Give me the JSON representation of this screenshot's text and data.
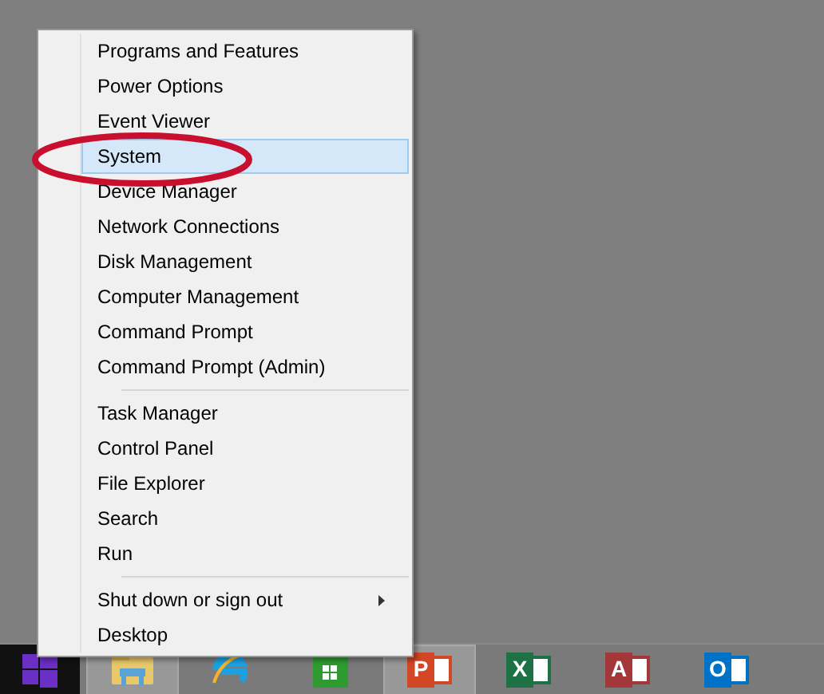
{
  "menu": {
    "groups": [
      {
        "items": [
          {
            "label": "Programs and Features",
            "selected": false,
            "has_submenu": false
          },
          {
            "label": "Power Options",
            "selected": false,
            "has_submenu": false
          },
          {
            "label": "Event Viewer",
            "selected": false,
            "has_submenu": false
          },
          {
            "label": "System",
            "selected": true,
            "has_submenu": false,
            "circled": true
          },
          {
            "label": "Device Manager",
            "selected": false,
            "has_submenu": false
          },
          {
            "label": "Network Connections",
            "selected": false,
            "has_submenu": false
          },
          {
            "label": "Disk Management",
            "selected": false,
            "has_submenu": false
          },
          {
            "label": "Computer Management",
            "selected": false,
            "has_submenu": false
          },
          {
            "label": "Command Prompt",
            "selected": false,
            "has_submenu": false
          },
          {
            "label": "Command Prompt (Admin)",
            "selected": false,
            "has_submenu": false
          }
        ]
      },
      {
        "items": [
          {
            "label": "Task Manager",
            "selected": false,
            "has_submenu": false
          },
          {
            "label": "Control Panel",
            "selected": false,
            "has_submenu": false
          },
          {
            "label": "File Explorer",
            "selected": false,
            "has_submenu": false
          },
          {
            "label": "Search",
            "selected": false,
            "has_submenu": false
          },
          {
            "label": "Run",
            "selected": false,
            "has_submenu": false
          }
        ]
      },
      {
        "items": [
          {
            "label": "Shut down or sign out",
            "selected": false,
            "has_submenu": true
          },
          {
            "label": "Desktop",
            "selected": false,
            "has_submenu": false
          }
        ]
      }
    ]
  },
  "taskbar": {
    "items": [
      {
        "kind": "start"
      },
      {
        "kind": "explorer",
        "active": true
      },
      {
        "kind": "browser",
        "active": false
      },
      {
        "kind": "store",
        "active": false
      },
      {
        "kind": "office",
        "glyph": "P",
        "color": "#d24726",
        "active": true
      },
      {
        "kind": "office",
        "glyph": "X",
        "color": "#1e7145",
        "active": false
      },
      {
        "kind": "office",
        "glyph": "A",
        "color": "#a4373a",
        "active": false
      },
      {
        "kind": "office",
        "glyph": "O",
        "color": "#0072c6",
        "active": false
      }
    ]
  }
}
